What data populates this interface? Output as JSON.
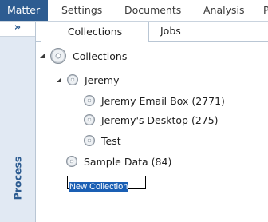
{
  "ribbon": {
    "tabs": [
      "Matter",
      "Settings",
      "Documents",
      "Analysis",
      "P"
    ],
    "active": "Matter"
  },
  "rail": {
    "toggle": "»",
    "label": "Process"
  },
  "subtabs": [
    "Collections",
    "Jobs"
  ],
  "tree": {
    "root": "Collections",
    "group": "Jeremy",
    "children": [
      "Jeremy Email Box (2771)",
      "Jeremy's Desktop (275)",
      "Test"
    ],
    "sibling": "Sample Data (84)",
    "new_item_input": "New Collection"
  },
  "colors": {
    "accent": "#2d5c91",
    "rail_bg": "#e1e9f3",
    "selection": "#1a5fb4"
  }
}
